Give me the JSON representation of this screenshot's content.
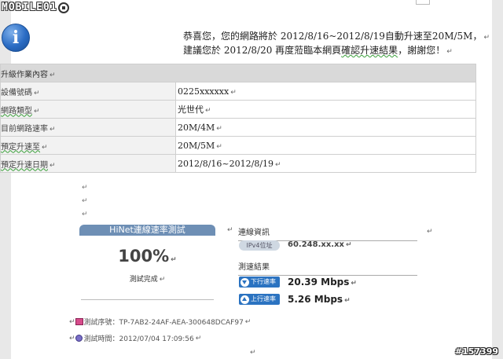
{
  "watermark": {
    "text": "MOBILE01"
  },
  "notice": {
    "icon": "info-icon",
    "line1": "恭喜您，您的網路將於 2012/8/16~2012/8/19自動升速至20M/5M，",
    "line2_a": "建議您於 2012/8/20 再度蒞臨本網頁",
    "line2_b": "確認升速結果",
    "line2_c": "，謝謝您！"
  },
  "table": {
    "header": "升級作業內容",
    "rows": [
      {
        "label": "設備號碼",
        "value": "0225xxxxxx"
      },
      {
        "label": "網路類型",
        "value": "光世代"
      },
      {
        "label": "目前網路速率",
        "value": "20M/4M"
      },
      {
        "label": "預定升速至",
        "value": "20M/5M"
      },
      {
        "label": "預定升速日期",
        "value": "2012/8/16~2012/8/19"
      }
    ]
  },
  "paragraph_mark": "↵",
  "speedtest": {
    "title": "HiNet連線速率測試",
    "percent": "100%",
    "status": "測試完成",
    "connection_heading": "連線資訊",
    "ip_label": "IPv4位址",
    "ip_value": "60.248.xx.xx",
    "results_heading": "測速結果",
    "download_label": "下行速率",
    "download_value": "20.39 Mbps",
    "upload_label": "上行速率",
    "upload_value": "5.26 Mbps",
    "serial_label": "測試序號：TP-7AB2-24AF-AEA-300648DCAF97",
    "time_label": "測試時間：2012/07/04 17:09:56"
  },
  "corner_id": "#157399",
  "colors": {
    "title_bar": "#6e8fb5",
    "badge": "#2b73c1",
    "table_header": "#d9d9d9"
  }
}
